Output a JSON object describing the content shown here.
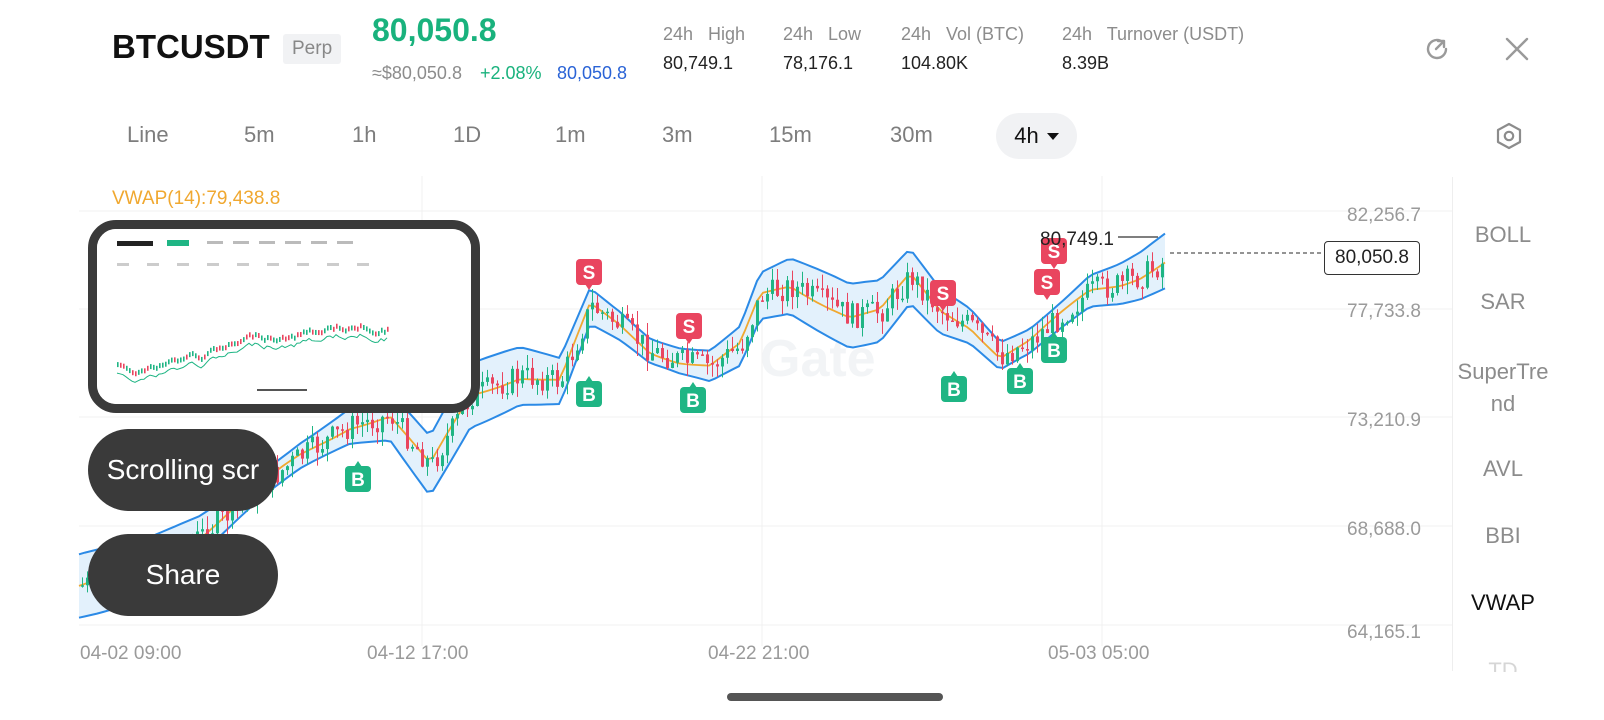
{
  "header": {
    "symbol": "BTCUSDT",
    "contract_type": "Perp",
    "last_price": "80,050.8",
    "approx_price": "≈$80,050.8",
    "change_pct": "+2.08%",
    "mark_price": "80,050.8",
    "stats": [
      {
        "label": "24h   High",
        "value": "80,749.1"
      },
      {
        "label": "24h   Low",
        "value": "78,176.1"
      },
      {
        "label": "24h   Vol (BTC)",
        "value": "104.80K"
      },
      {
        "label": "24h   Turnover (USDT)",
        "value": "8.39B"
      }
    ]
  },
  "timeframes": [
    "Line",
    "5m",
    "1h",
    "1D",
    "1m",
    "3m",
    "15m",
    "30m"
  ],
  "active_timeframe": "4h",
  "indicator_label": "VWAP(14):79,438.8",
  "chart_data": {
    "type": "candlestick",
    "y_ticks": [
      "82,256.7",
      "77,733.8",
      "73,210.9",
      "68,688.0",
      "64,165.1"
    ],
    "x_ticks": [
      "04-02 09:00",
      "04-12 17:00",
      "04-22 21:00",
      "05-03 05:00"
    ],
    "ylim": [
      64165.1,
      82256.7
    ],
    "high_marker": "80,749.1",
    "last_price_marker": "80,050.8",
    "signals": [
      {
        "type": "S"
      },
      {
        "type": "S"
      },
      {
        "type": "S"
      },
      {
        "type": "S"
      },
      {
        "type": "S"
      },
      {
        "type": "S"
      },
      {
        "type": "B"
      },
      {
        "type": "B"
      },
      {
        "type": "B"
      },
      {
        "type": "B"
      },
      {
        "type": "B"
      },
      {
        "type": "B"
      }
    ],
    "colors": {
      "up": "#1fb584",
      "down": "#e9455f",
      "band": "#2b8ae6",
      "band_fill": "#e3f1fc",
      "mid": "#f0a830"
    }
  },
  "indicators": [
    "BOLL",
    "SAR",
    "SuperTre\nnd",
    "AVL",
    "BBI",
    "VWAP",
    "TD"
  ],
  "overlay": {
    "scroll_label": "Scrolling scr",
    "share_label": "Share"
  }
}
